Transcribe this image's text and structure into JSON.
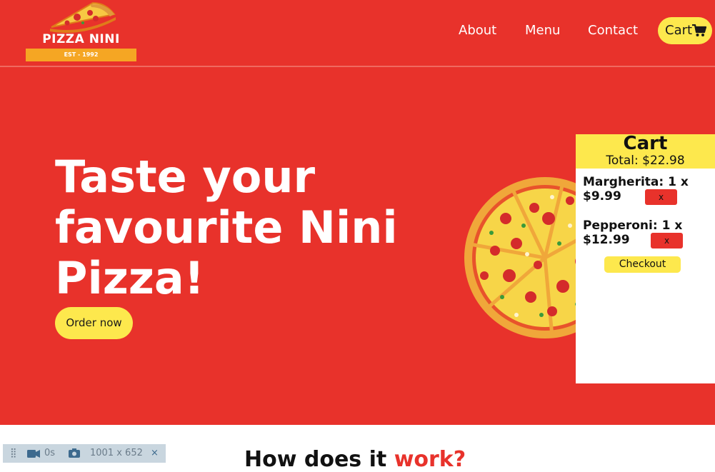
{
  "logo": {
    "name": "PIZZA NINI",
    "est": "EST - 1992"
  },
  "nav": {
    "about": "About",
    "menu": "Menu",
    "contact": "Contact",
    "cart": "Cart",
    "cart_icon": "shopping-cart-icon"
  },
  "hero": {
    "title_line1": "Taste your",
    "title_line2": "favourite Nini",
    "title_line3": "Pizza!",
    "order_button": "Order now"
  },
  "cart": {
    "title": "Cart",
    "total": "Total: $22.98",
    "items": [
      {
        "line1": "Margherita: 1 x",
        "line2": "$9.99",
        "remove": "x"
      },
      {
        "line1": "Pepperoni: 1 x",
        "line2": "$12.99",
        "remove": "x"
      }
    ],
    "checkout": "Checkout"
  },
  "section": {
    "title_prefix": "How does it ",
    "title_accent": "work?"
  },
  "devbar": {
    "time": "0s",
    "size": "1001 x 652",
    "close": "×"
  },
  "colors": {
    "brand_red": "#e8322b",
    "accent_yellow": "#fde84d",
    "logo_orange": "#f5a623"
  }
}
